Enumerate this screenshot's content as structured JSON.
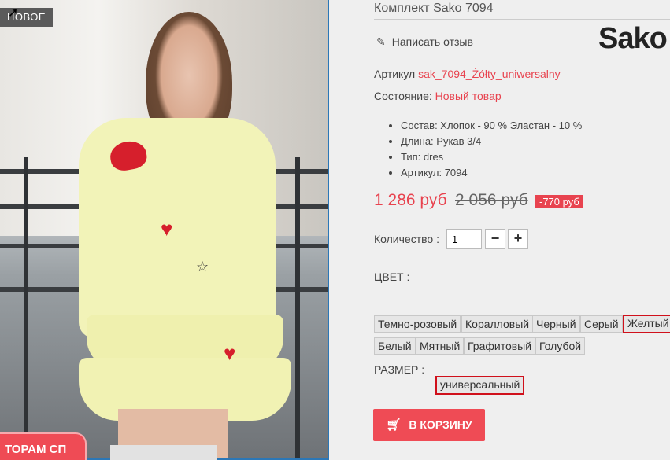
{
  "badge": {
    "new_label": "НОВОЕ"
  },
  "promo": {
    "label": "ТОРАМ СП"
  },
  "product": {
    "title": "Комплект Sako 7094",
    "review_label": "Написать отзыв",
    "brand_logo": "Sako",
    "sku_label": "Артикул",
    "sku_value": "sak_7094_Żółty_uniwersalny",
    "condition_label": "Состояние:",
    "condition_value": "Новый товар",
    "specs": [
      "Состав: Хлопок - 90 % Эластан - 10 %",
      "Длина: Рукав 3/4",
      "Тип: dres",
      "Артикул: 7094"
    ],
    "price_new": "1 286 руб",
    "price_old": "2 056 руб",
    "discount": "-770 руб",
    "quantity_label": "Количество :",
    "quantity_value": "1",
    "minus_label": "−",
    "plus_label": "+",
    "color_label": "ЦВЕТ :",
    "colors": [
      "Темно-розовый",
      "Коралловый",
      "Черный",
      "Серый",
      "Желтый",
      "Белый",
      "Мятный",
      "Графитовый",
      "Голубой"
    ],
    "selected_color": "Желтый",
    "size_label": "РАЗМЕР :",
    "sizes": [
      "универсальный"
    ],
    "selected_size": "универсальный",
    "cart_label": "В КОРЗИНУ"
  },
  "colors": {
    "accent": "#e8434f",
    "selected_border": "#d0101b",
    "button": "#ef4b55"
  },
  "icons": {
    "pencil": "pencil-icon",
    "cart": "cart-icon",
    "cursor": "cursor-icon"
  }
}
